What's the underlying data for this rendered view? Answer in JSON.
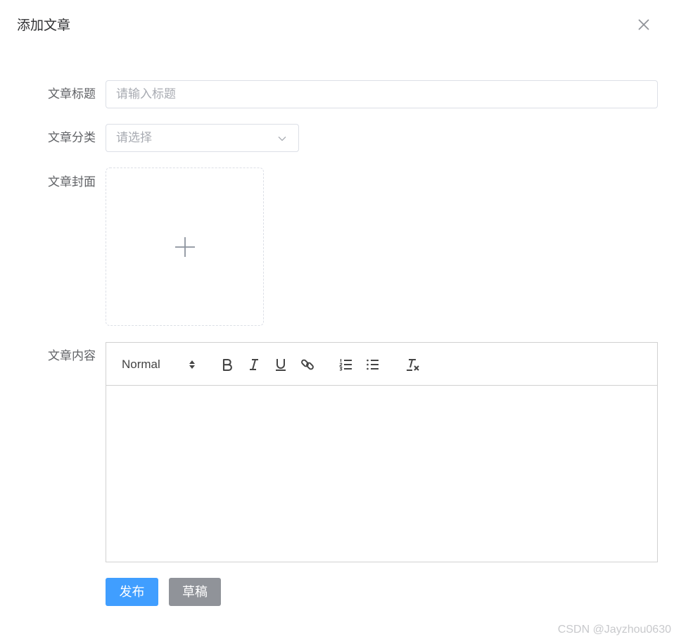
{
  "dialog": {
    "title": "添加文章",
    "close_icon": "close-icon"
  },
  "form": {
    "title": {
      "label": "文章标题",
      "value": "",
      "placeholder": "请输入标题"
    },
    "category": {
      "label": "文章分类",
      "value": "",
      "placeholder": "请选择",
      "icon": "chevron-down-icon"
    },
    "cover": {
      "label": "文章封面",
      "icon": "plus-icon"
    },
    "content": {
      "label": "文章内容",
      "toolbar": {
        "header_value": "Normal",
        "buttons": [
          "bold-icon",
          "italic-icon",
          "underline-icon",
          "link-icon",
          "ordered-list-icon",
          "bullet-list-icon",
          "clear-format-icon"
        ]
      },
      "body": ""
    }
  },
  "actions": {
    "publish_label": "发布",
    "draft_label": "草稿"
  },
  "colors": {
    "primary": "#409eff",
    "info": "#909399",
    "border": "#dcdfe6",
    "toolbar_icon": "#444444"
  },
  "watermark": "CSDN @Jayzhou0630"
}
